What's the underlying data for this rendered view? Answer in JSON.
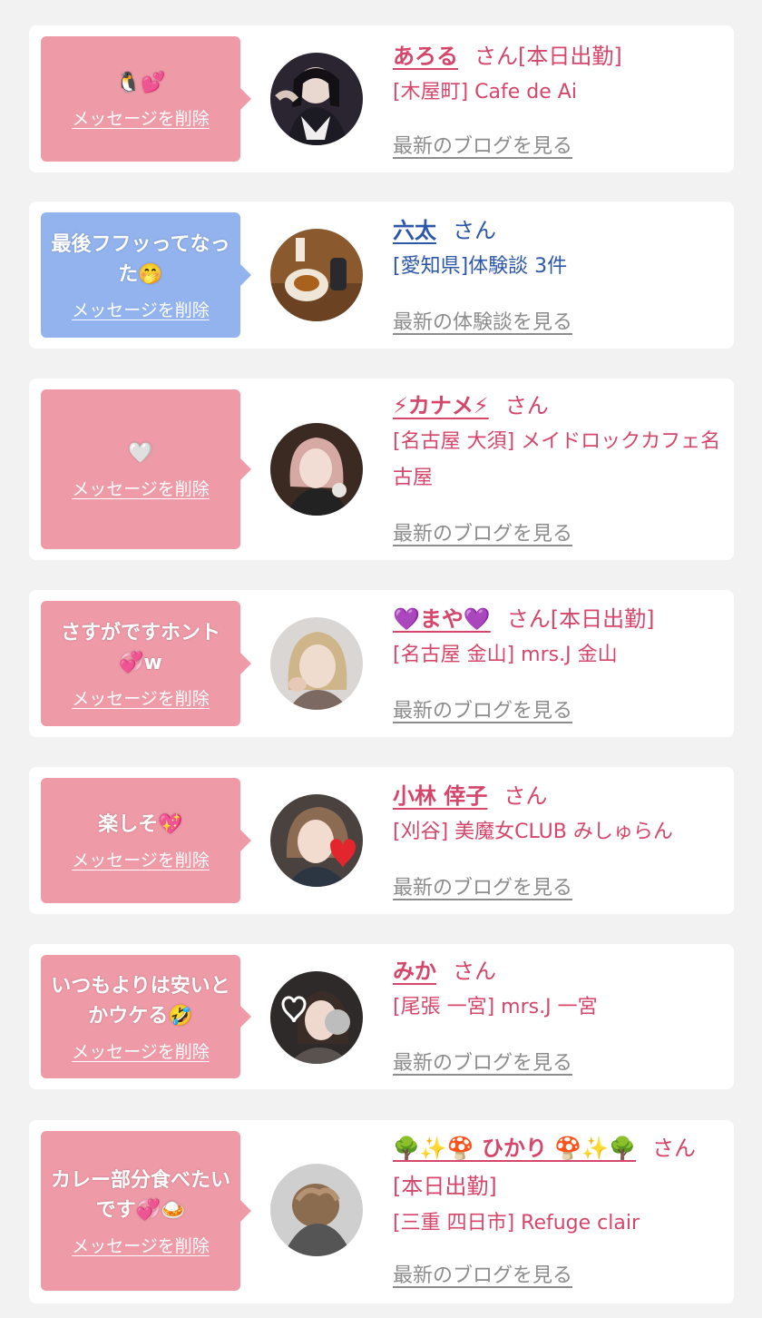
{
  "delete_label": "メッセージを削除",
  "colors": {
    "page_bg": "#f2f2f2",
    "card_bg": "#ffffff",
    "bubble_pink": "#ef9aa7",
    "bubble_blue": "#92b3ee",
    "text_pink": "#d6456a",
    "text_blue": "#2d57a8",
    "link_gray": "#8c8c8c"
  },
  "messages": [
    {
      "message": "🐧💕",
      "name": "あろる",
      "san": "さん[本日出勤]",
      "shop": "[木屋町] Cafe de Ai",
      "blog_link": "最新のブログを見る",
      "avatar_icon": "girl-photo-avatar"
    },
    {
      "message": "最後フフッってなった🤭",
      "name": "六太",
      "san": "さん",
      "shop": "[愛知県]体験談 3件",
      "blog_link": "最新の体験談を見る",
      "avatar_icon": "food-photo-avatar"
    },
    {
      "message": "🤍",
      "name": "⚡カナメ⚡",
      "san": "さん",
      "shop": "[名古屋 大須] メイドロックカフェ名古屋",
      "blog_link": "最新のブログを見る",
      "avatar_icon": "girl-photo-avatar"
    },
    {
      "message": "さすがですホント💞w",
      "name": "💜まや💜",
      "san": "さん[本日出勤]",
      "shop": "[名古屋 金山] mrs.J 金山",
      "blog_link": "最新のブログを見る",
      "avatar_icon": "girl-photo-avatar"
    },
    {
      "message": "楽しそ💖",
      "name": "小林 倖子",
      "san": "さん",
      "shop": "[刈谷] 美魔女CLUB みしゅらん",
      "blog_link": "最新のブログを見る",
      "avatar_icon": "girl-photo-avatar"
    },
    {
      "message": "いつもよりは安いとかウケる🤣",
      "name": "みか",
      "san": "さん",
      "shop": "[尾張 一宮] mrs.J 一宮",
      "blog_link": "最新のブログを見る",
      "avatar_icon": "girl-photo-avatar"
    },
    {
      "message": "カレー部分食べたいです💞🍛",
      "name": "🌳✨🍄 ひかり 🍄✨🌳",
      "san": "さん[本日出勤]",
      "shop": "[三重 四日市] Refuge clair",
      "blog_link": "最新のブログを見る",
      "avatar_icon": "girl-photo-avatar"
    }
  ]
}
